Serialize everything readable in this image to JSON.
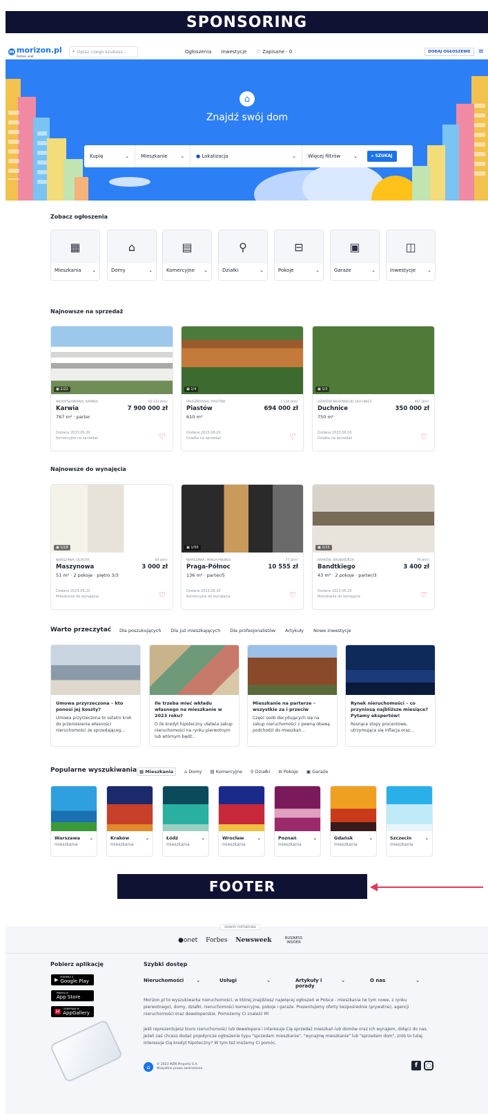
{
  "sponsor_label": "SPONSORING",
  "header": {
    "logo": "morizon.pl",
    "logo_partner": "Partner onet",
    "search_placeholder": "Opisz czego szukasz...",
    "nav": [
      "Ogłoszenia",
      "Inwestycje",
      "Zapisane · 0"
    ],
    "add_button": "DODAJ OGŁOSZENIE"
  },
  "hero": {
    "title": "Znajdź swój dom",
    "fields": [
      "Kupię",
      "Mieszkanie",
      "Lokalizacja",
      "Więcej filtrów"
    ],
    "search_button": "SZUKAJ"
  },
  "categories": {
    "title": "Zobacz ogłoszenia",
    "items": [
      {
        "label": "Mieszkania",
        "icon": "building-icon",
        "glyph": "▦"
      },
      {
        "label": "Domy",
        "icon": "house-icon",
        "glyph": "⌂"
      },
      {
        "label": "Komercyjne",
        "icon": "shop-icon",
        "glyph": "▤"
      },
      {
        "label": "Działki",
        "icon": "plot-icon",
        "glyph": "⚲"
      },
      {
        "label": "Pokoje",
        "icon": "bed-icon",
        "glyph": "⊟"
      },
      {
        "label": "Garaże",
        "icon": "garage-icon",
        "glyph": "▣"
      },
      {
        "label": "Inwestycje",
        "icon": "investment-icon",
        "glyph": "◫"
      }
    ]
  },
  "sale": {
    "title": "Najnowsze na sprzedaż",
    "cards": [
      {
        "count": "1/22",
        "location": "WŁADYSŁAWOWO, KARWIA",
        "ppm": "10 333 zł/m²",
        "name": "Karwia",
        "price": "7 900 000 zł",
        "details": "767 m² · parter",
        "date": "Dodane 2023.06.20",
        "type": "Komercyjne na sprzedaż"
      },
      {
        "count": "1/4",
        "location": "PRUSZKOWSKI, PIASTÓW",
        "ppm": "1 138 zł/m²",
        "name": "Piastów",
        "price": "694 000 zł",
        "details": "610 m²",
        "date": "Dodane 2023.06.20",
        "type": "Działka na sprzedaż"
      },
      {
        "count": "1/3",
        "location": "OŻARÓW MAZOWIECKI, DUCHNICE",
        "ppm": "467 zł/m²",
        "name": "Duchnice",
        "price": "350 000 zł",
        "details": "750 m²",
        "date": "Dodane 2023.06.20",
        "type": "Działka na sprzedaż"
      }
    ]
  },
  "rent": {
    "title": "Najnowsze do wynajęcia",
    "cards": [
      {
        "count": "1/18",
        "location": "WARSZAWA, OCHOTA",
        "ppm": "59 zł/m²",
        "name": "Maszynowa",
        "price": "3 000 zł",
        "details": "51 m² · 2 pokoje · piętro 3/3",
        "date": "Dodane 2023.06.20",
        "type": "Mieszkanie do wynajęcia"
      },
      {
        "count": "1/50",
        "location": "WARSZAWA, PRAGA-PÓŁNOC",
        "ppm": "77 zł/m²",
        "name": "Praga-Północ",
        "price": "10 555 zł",
        "details": "136 m² · parter/5",
        "date": "Dodane 2023.06.20",
        "type": "Komercyjne do wynajęcia"
      },
      {
        "count": "1/15",
        "location": "KRAKÓW, KROWODRZA",
        "ppm": "79 zł/m²",
        "name": "Bandtkiego",
        "price": "3 400 zł",
        "details": "43 m² · 2 pokoje · parter/3",
        "date": "Dodane 2023.06.20",
        "type": "Mieszkanie do wynajęcia"
      }
    ]
  },
  "articles": {
    "title": "Warto przeczytać",
    "tabs": [
      "Dla poszukujących",
      "Dla już mieszkających",
      "Dla profesjonalistów",
      "Artykuły",
      "Nowe inwestycje"
    ],
    "items": [
      {
        "title": "Umowa przyrzeczona – kto ponosi jej koszty?",
        "text": "Umowa przyrzeczona to ostatni krok do przeniesienia własności nieruchomości ze sprzedająceg..."
      },
      {
        "title": "Ile trzeba mieć wkładu własnego na mieszkanie w 2023 roku?",
        "text": "O ile kredyt hipoteczny ułatwia zakup nieruchomości na rynku pierwotnym lub wtórnym będź..."
      },
      {
        "title": "Mieszkanie na parterze – wszystkie za i przeciw",
        "text": "Część osób decydujących się na zakup nieruchomości z pewną obawą podchodzi do mieszkań..."
      },
      {
        "title": "Rynek nieruchomości – co przyniosą najbliższe miesiące? Pytamy ekspertów!",
        "text": "Rosnące stopy procentowe, utrzymująca się inflacja oraz..."
      }
    ]
  },
  "popular": {
    "title": "Popularne wyszukiwania",
    "tabs": [
      "Mieszkania",
      "Domy",
      "Komercyjne",
      "Działki",
      "Pokoje",
      "Garaże"
    ],
    "items": [
      {
        "city": "Warszawa",
        "sub": "mieszkania"
      },
      {
        "city": "Kraków",
        "sub": "mieszkania"
      },
      {
        "city": "Łódź",
        "sub": "mieszkania"
      },
      {
        "city": "Wrocław",
        "sub": "mieszkania"
      },
      {
        "city": "Poznań",
        "sub": "mieszkania"
      },
      {
        "city": "Gdańsk",
        "sub": "mieszkania"
      },
      {
        "city": "Szczecin",
        "sub": "mieszkania"
      }
    ]
  },
  "footer_label": "FOOTER",
  "footer": {
    "partners_label": "SERWISY PARTNERSKIE",
    "partners": [
      "onet",
      "Forbes",
      "Newsweek",
      "BUSINESS INSIDER"
    ],
    "apps_title": "Pobierz aplikację",
    "badges": [
      {
        "small": "POBIERZ Z",
        "name": "Google Play"
      },
      {
        "small": "Pobierz w",
        "name": "App Store"
      },
      {
        "small": "ODKRYWAJ W",
        "name": "AppGallery"
      }
    ],
    "quick_title": "Szybki dostęp",
    "quick": [
      "Nieruchomości",
      "Usługi",
      "Artykuły i porady",
      "O nas"
    ],
    "text1": "Morizon.pl to wyszukiwarka nieruchomości, w której znajdziesz najwięcej ogłoszeń w Polsce - mieszkania (w tym nowe, z rynku pierwotnego), domy, działki, nieruchomości komercyjne, pokoje i garaże. Prezentujemy oferty bezpośrednie (prywatne), agencji nieruchomości oraz deweloperskie. Pomożemy Ci znaleźć M!",
    "text2": "Jeśli reprezentujesz biuro nieruchomości lub dewelopera i interesuje Cię sprzedaż mieszkań lub domów oraz ich wynajem, dołącz do nas. Jeżeli zaś chcesz dodać pojedyncze ogłoszenie typu \"sprzedam mieszkanie\", \"wynajmę mieszkanie\" lub \"sprzedam dom\", zrób to tutaj. Interesuje Cię kredyt hipoteczny? W tym też możemy Ci pomóc.",
    "copyright": "© 2023 MZN Property S.A.",
    "rights": "Wszystkie prawa zastrzeżone."
  }
}
